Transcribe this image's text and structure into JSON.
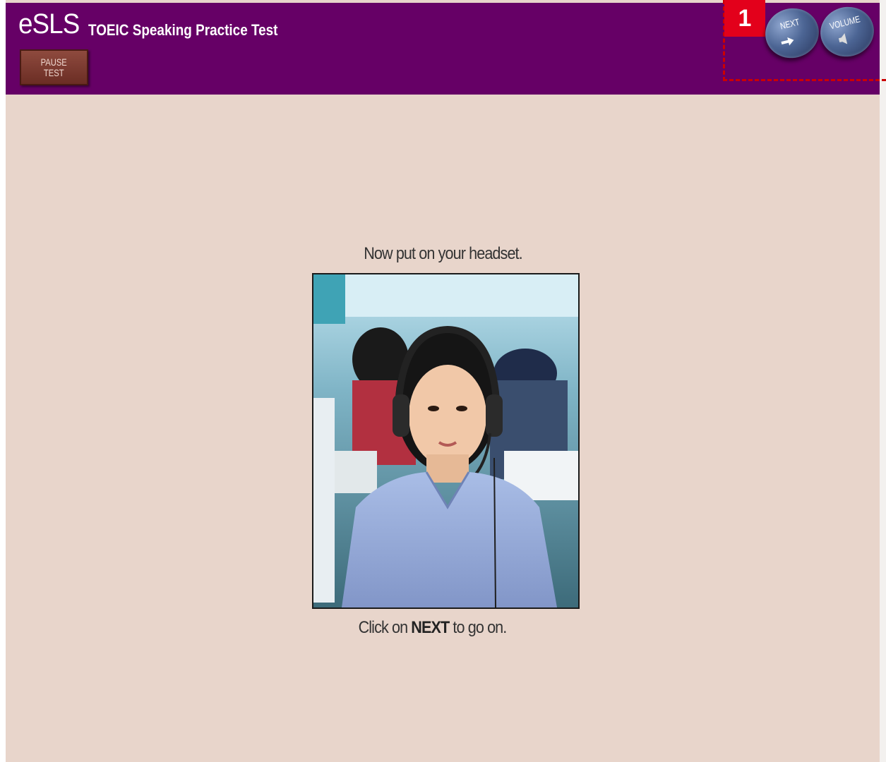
{
  "header": {
    "logo": "eSLS",
    "title": "TOEIC Speaking Practice Test",
    "pause_label": "PAUSE\nTEST",
    "next_label": "NEXT",
    "volume_label": "VOLUME",
    "background_color": "#660066"
  },
  "callout": {
    "number": "1",
    "color": "#e3001b"
  },
  "main": {
    "prompt": "Now put on your headset.",
    "instruction_prefix": "Click on",
    "instruction_keyword": "NEXT",
    "instruction_suffix": "to go on.",
    "background_color": "#e8d5cb"
  },
  "icons": {
    "next": "arrow-right-icon",
    "volume": "speaker-icon"
  }
}
